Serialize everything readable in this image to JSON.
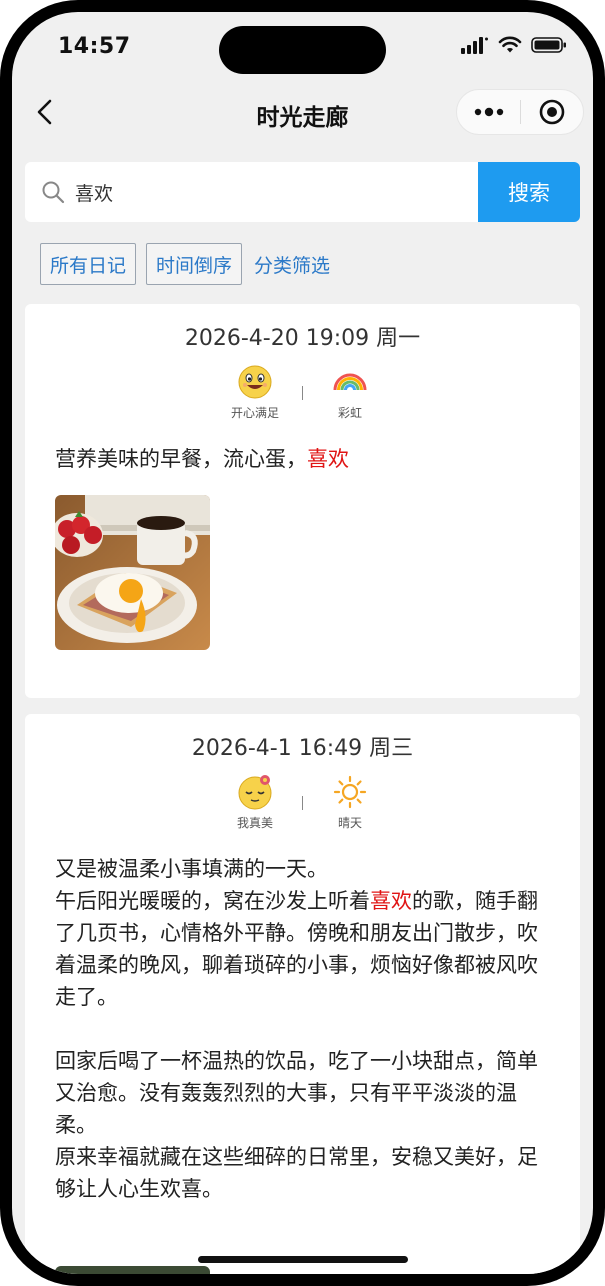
{
  "status_bar": {
    "time": "14:57"
  },
  "nav": {
    "title": "时光走廊"
  },
  "search": {
    "placeholder": "喜欢",
    "value": "喜欢",
    "button_label": "搜索"
  },
  "filters": {
    "all_label": "所有日记",
    "order_label": "时间倒序",
    "category_label": "分类筛选"
  },
  "entries": [
    {
      "date": "2026-4-20 19:09 周一",
      "moods": [
        {
          "label": "开心满足",
          "icon": "happy-face-icon"
        },
        {
          "label": "彩虹",
          "icon": "rainbow-icon"
        }
      ],
      "content": [
        {
          "parts": [
            {
              "text": "营养美味的早餐，流心蛋，",
              "hl": false
            },
            {
              "text": "喜欢",
              "hl": true
            }
          ]
        }
      ],
      "photo": "breakfast-photo"
    },
    {
      "date": "2026-4-1 16:49 周三",
      "moods": [
        {
          "label": "我真美",
          "icon": "blushing-face-icon"
        },
        {
          "label": "晴天",
          "icon": "sun-icon"
        }
      ],
      "content": [
        {
          "parts": [
            {
              "text": "又是被温柔小事填满的一天。",
              "hl": false
            }
          ]
        },
        {
          "parts": [
            {
              "text": "午后阳光暖暖的，窝在沙发上听着",
              "hl": false
            },
            {
              "text": "喜欢",
              "hl": true
            },
            {
              "text": "的歌，随手翻了几页书，心情格外平静。傍晚和朋友出门散步，吹着温柔的晚风，聊着琐碎的小事，烦恼好像都被风吹走了。",
              "hl": false
            }
          ]
        },
        {
          "parts": [
            {
              "text": "",
              "hl": false
            }
          ]
        },
        {
          "parts": [
            {
              "text": "回家后喝了一杯温热的饮品，吃了一小块甜点，简单又治愈。没有轰轰烈烈的大事，只有平平淡淡的温柔。",
              "hl": false
            }
          ]
        },
        {
          "parts": [
            {
              "text": "原来幸福就藏在这些细碎的日常里，安稳又美好，足够让人心生欢喜。",
              "hl": false
            }
          ]
        }
      ]
    }
  ],
  "colors": {
    "accent": "#1e9bf0",
    "highlight": "#e01515",
    "link": "#2b79c8"
  }
}
